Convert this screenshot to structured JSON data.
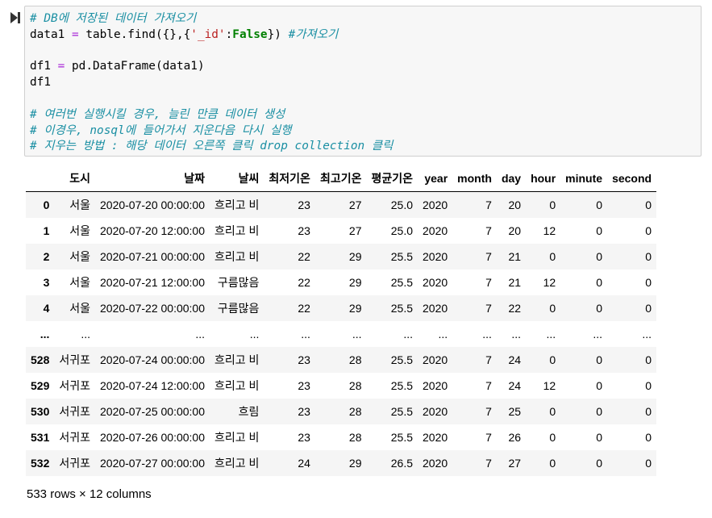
{
  "code": {
    "line1": "# DB에 저장된 데이터 가져오기",
    "line2_a": "data1 ",
    "line2_eq": "=",
    "line2_b": " table.find({},{",
    "line2_str": "'_id'",
    "line2_colon": ":",
    "line2_kw": "False",
    "line2_c": "}) ",
    "line2_cm": "#가져오기",
    "line3": "",
    "line4_a": "df1 ",
    "line4_eq": "=",
    "line4_b": " pd.DataFrame(data1)",
    "line5": "df1",
    "line6": "",
    "line7": "# 여러번 실행시킬 경우, 늘린 만큼 데이터 생성",
    "line8": "# 이경우, nosql에 들어가서 지운다음 다시 실행",
    "line9": "# 지우는 방법 : 해당 데이터 오른쪽 클릭 drop collection 클릭"
  },
  "table": {
    "columns": [
      "",
      "도시",
      "날짜",
      "날씨",
      "최저기온",
      "최고기온",
      "평균기온",
      "year",
      "month",
      "day",
      "hour",
      "minute",
      "second"
    ],
    "rows": [
      [
        "0",
        "서울",
        "2020-07-20 00:00:00",
        "흐리고 비",
        "23",
        "27",
        "25.0",
        "2020",
        "7",
        "20",
        "0",
        "0",
        "0"
      ],
      [
        "1",
        "서울",
        "2020-07-20 12:00:00",
        "흐리고 비",
        "23",
        "27",
        "25.0",
        "2020",
        "7",
        "20",
        "12",
        "0",
        "0"
      ],
      [
        "2",
        "서울",
        "2020-07-21 00:00:00",
        "흐리고 비",
        "22",
        "29",
        "25.5",
        "2020",
        "7",
        "21",
        "0",
        "0",
        "0"
      ],
      [
        "3",
        "서울",
        "2020-07-21 12:00:00",
        "구름많음",
        "22",
        "29",
        "25.5",
        "2020",
        "7",
        "21",
        "12",
        "0",
        "0"
      ],
      [
        "4",
        "서울",
        "2020-07-22 00:00:00",
        "구름많음",
        "22",
        "29",
        "25.5",
        "2020",
        "7",
        "22",
        "0",
        "0",
        "0"
      ],
      [
        "...",
        "...",
        "...",
        "...",
        "...",
        "...",
        "...",
        "...",
        "...",
        "...",
        "...",
        "...",
        "..."
      ],
      [
        "528",
        "서귀포",
        "2020-07-24 00:00:00",
        "흐리고 비",
        "23",
        "28",
        "25.5",
        "2020",
        "7",
        "24",
        "0",
        "0",
        "0"
      ],
      [
        "529",
        "서귀포",
        "2020-07-24 12:00:00",
        "흐리고 비",
        "23",
        "28",
        "25.5",
        "2020",
        "7",
        "24",
        "12",
        "0",
        "0"
      ],
      [
        "530",
        "서귀포",
        "2020-07-25 00:00:00",
        "흐림",
        "23",
        "28",
        "25.5",
        "2020",
        "7",
        "25",
        "0",
        "0",
        "0"
      ],
      [
        "531",
        "서귀포",
        "2020-07-26 00:00:00",
        "흐리고 비",
        "23",
        "28",
        "25.5",
        "2020",
        "7",
        "26",
        "0",
        "0",
        "0"
      ],
      [
        "532",
        "서귀포",
        "2020-07-27 00:00:00",
        "흐리고 비",
        "24",
        "29",
        "26.5",
        "2020",
        "7",
        "27",
        "0",
        "0",
        "0"
      ]
    ]
  },
  "dimensions": "533 rows × 12 columns",
  "icons": {
    "run": "run-cell-icon"
  },
  "colors": {
    "comment": "#1a8fa3",
    "operator": "#a51fd6",
    "string": "#ba2121",
    "keyword": "#008000",
    "cell_bg": "#f7f7f7",
    "row_stripe": "#f5f5f5"
  }
}
